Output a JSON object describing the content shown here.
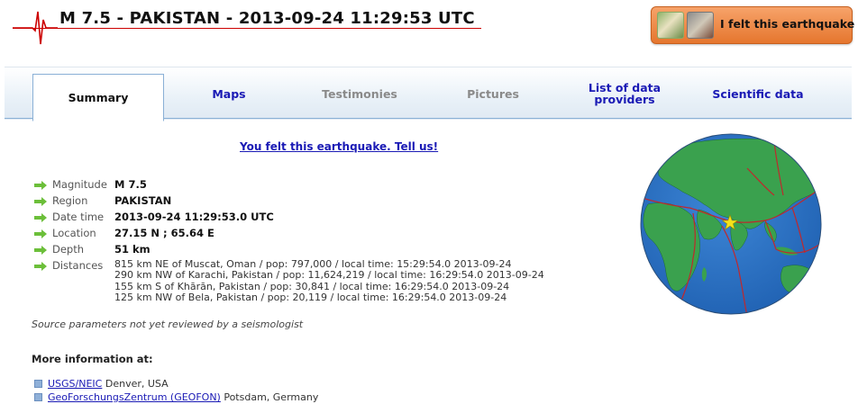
{
  "header": {
    "title": "M 7.5 - PAKISTAN - 2013-09-24 11:29:53 UTC",
    "felt_button": "I felt this earthquake"
  },
  "tabs": [
    {
      "label": "Summary",
      "state": "active"
    },
    {
      "label": "Maps",
      "state": "link"
    },
    {
      "label": "Testimonies",
      "state": "disabled"
    },
    {
      "label": "Pictures",
      "state": "disabled"
    },
    {
      "label": "List of data providers",
      "state": "link"
    },
    {
      "label": "Scientific data",
      "state": "link"
    }
  ],
  "tell_us": "You felt this earthquake. Tell us!",
  "params": {
    "magnitude": {
      "label": "Magnitude",
      "value": "M 7.5"
    },
    "region": {
      "label": "Region",
      "value": "PAKISTAN"
    },
    "date_time": {
      "label": "Date time",
      "value": "2013-09-24 11:29:53.0 UTC"
    },
    "location": {
      "label": "Location",
      "value": "27.15 N ; 65.64 E"
    },
    "depth": {
      "label": "Depth",
      "value": "51 km"
    },
    "distances": {
      "label": "Distances",
      "items": [
        "815 km NE of Muscat, Oman / pop: 797,000 / local time: 15:29:54.0 2013-09-24",
        "290 km NW of Karachi, Pakistan / pop: 11,624,219 / local time: 16:29:54.0 2013-09-24",
        "155 km S of Khārān, Pakistan / pop: 30,841 / local time: 16:29:54.0 2013-09-24",
        "125 km NW of Bela, Pakistan / pop: 20,119 / local time: 16:29:54.0 2013-09-24"
      ]
    }
  },
  "source_note": "Source parameters not yet reviewed by a seismologist",
  "more_info": {
    "heading": "More information at:",
    "links": [
      {
        "link": "USGS/NEIC",
        "rest": " Denver, USA"
      },
      {
        "link": "GeoForschungsZentrum (GEOFON)",
        "rest": " Potsdam, Germany"
      }
    ]
  },
  "colors": {
    "link": "#1a1ab5",
    "accent_orange": "#e5762e",
    "arrow_green": "#6cbf3a",
    "ocean": "#2e74c8",
    "land": "#3aa14e",
    "plate_boundary": "#c0282c"
  },
  "icons": {
    "logo": "seismogram-icon",
    "arrow": "green-arrow-icon",
    "epicenter": "star-icon"
  }
}
